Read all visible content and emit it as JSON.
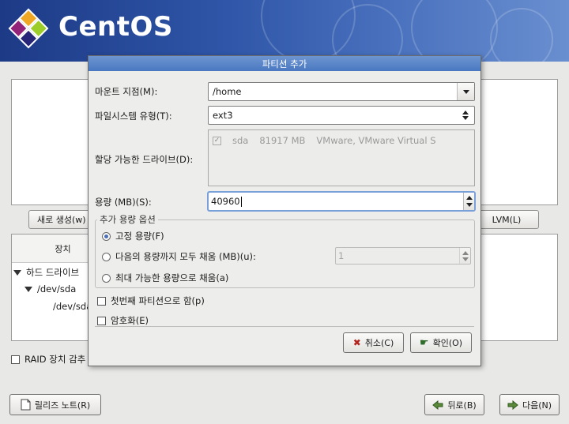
{
  "banner": {
    "logo_text": "CentOS"
  },
  "background": {
    "new_button": "새로 생성(w)",
    "lvm_button": "LVM(L)",
    "tree": {
      "column_device": "장치",
      "rows": [
        "하드 드라이브",
        "/dev/sda",
        "/dev/sda"
      ]
    },
    "raid_checkbox": "RAID 장치 감추"
  },
  "dialog": {
    "title": "파티션 추가",
    "mount_point_label": "마운트 지점(M):",
    "mount_point_value": "/home",
    "fs_type_label": "파일시스템 유형(T):",
    "fs_type_value": "ext3",
    "drives_label": "할당 가능한 드라이브(D):",
    "drives": [
      {
        "checked": true,
        "name": "sda",
        "size": "81917 MB",
        "model": "VMware, VMware Virtual S"
      }
    ],
    "size_label": "용량 (MB)(S):",
    "size_value": "40960",
    "options_legend": "추가 용량 옵션",
    "option_fixed": "고정 용량(F)",
    "option_fill_up_to": "다음의 용량까지 모두 채움 (MB)(u):",
    "fill_up_to_value": "1",
    "option_fill_max": "최대 가능한 용량으로 채움(a)",
    "primary_checkbox": "첫번째 파티션으로 함(p)",
    "encrypt_checkbox": "암호화(E)",
    "cancel_button": "취소(C)",
    "ok_button": "확인(O)"
  },
  "bottom": {
    "release_notes_button": "릴리즈 노트(R)",
    "back_button": "뒤로(B)",
    "next_button": "다음(N)"
  },
  "colors": {
    "titlebar": "#4a78c1",
    "banner": "#2f56a8"
  }
}
